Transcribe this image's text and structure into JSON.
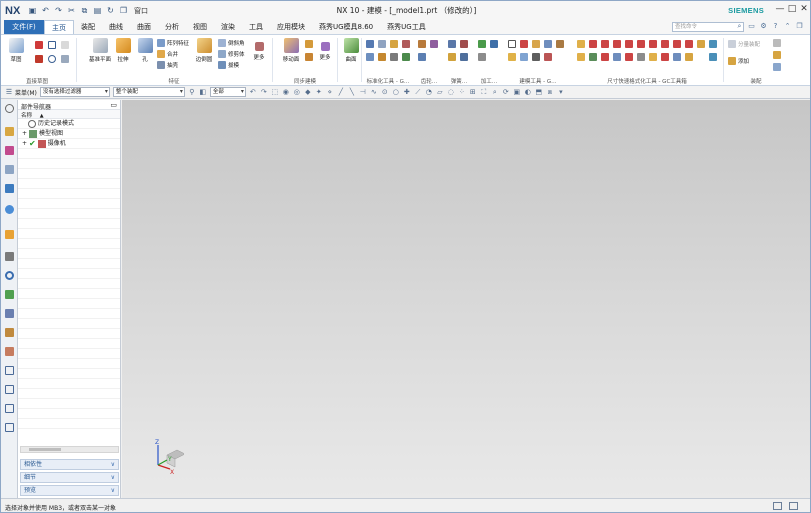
{
  "app": {
    "logo": "NX",
    "window_title": "NX 10 - 建模 - [_model1.prt （修改的）]",
    "brand": "SIEMENS",
    "window_menu": "窗口"
  },
  "tabs": {
    "file": "文件(F)",
    "items": [
      "主页",
      "装配",
      "曲线",
      "曲面",
      "分析",
      "视图",
      "渲染",
      "工具",
      "应用模块",
      "燕秀UG模具8.60",
      "燕秀UG工具"
    ]
  },
  "command_search": {
    "placeholder": "查找命令"
  },
  "ribbon": {
    "groups": {
      "sketch": "直接草图",
      "feature": "特征",
      "sync": "同步建模",
      "std": "标准化工具 - G…",
      "gear": "齿轮…",
      "spring": "弹簧…",
      "process": "加工…",
      "build": "建模工具 - G…",
      "dim": "尺寸快速格式化工具 - GC工具箱",
      "assembly": "装配"
    },
    "buttons": {
      "sketch": "草图",
      "datum": "基准平面",
      "extrude": "拉伸",
      "hole": "孔",
      "array": "阵列特征",
      "unite": "合并",
      "shell": "抽壳",
      "edge_blend": "边倒圆",
      "chamfer": "倒斜角",
      "trim_body": "修剪体",
      "draft": "拔模",
      "more1": "更多",
      "move_face": "移动面",
      "more2": "更多",
      "surface": "曲面",
      "comp_asm": "分量装配",
      "add": "添加"
    }
  },
  "toolbar2": {
    "menu": "菜单(M)",
    "filter": "没有选择过滤器",
    "scope": "整个装配",
    "all": "全部"
  },
  "navigator": {
    "title": "部件导航器",
    "col_name": "名称",
    "items": [
      "历史记录模式",
      "模型视图",
      "摄像机"
    ],
    "panels": [
      "相依性",
      "细节",
      "预览"
    ]
  },
  "triad": {
    "x": "X",
    "y": "Y",
    "z": "Z"
  },
  "status": {
    "text": "选择对象并使用 MB3，或者双击某一对象"
  },
  "colors": {
    "accent": "#2e6fb7",
    "siemens": "#1a9aa0",
    "viewport_top": "#c6c6c6",
    "viewport_bottom": "#e9e9e9"
  }
}
